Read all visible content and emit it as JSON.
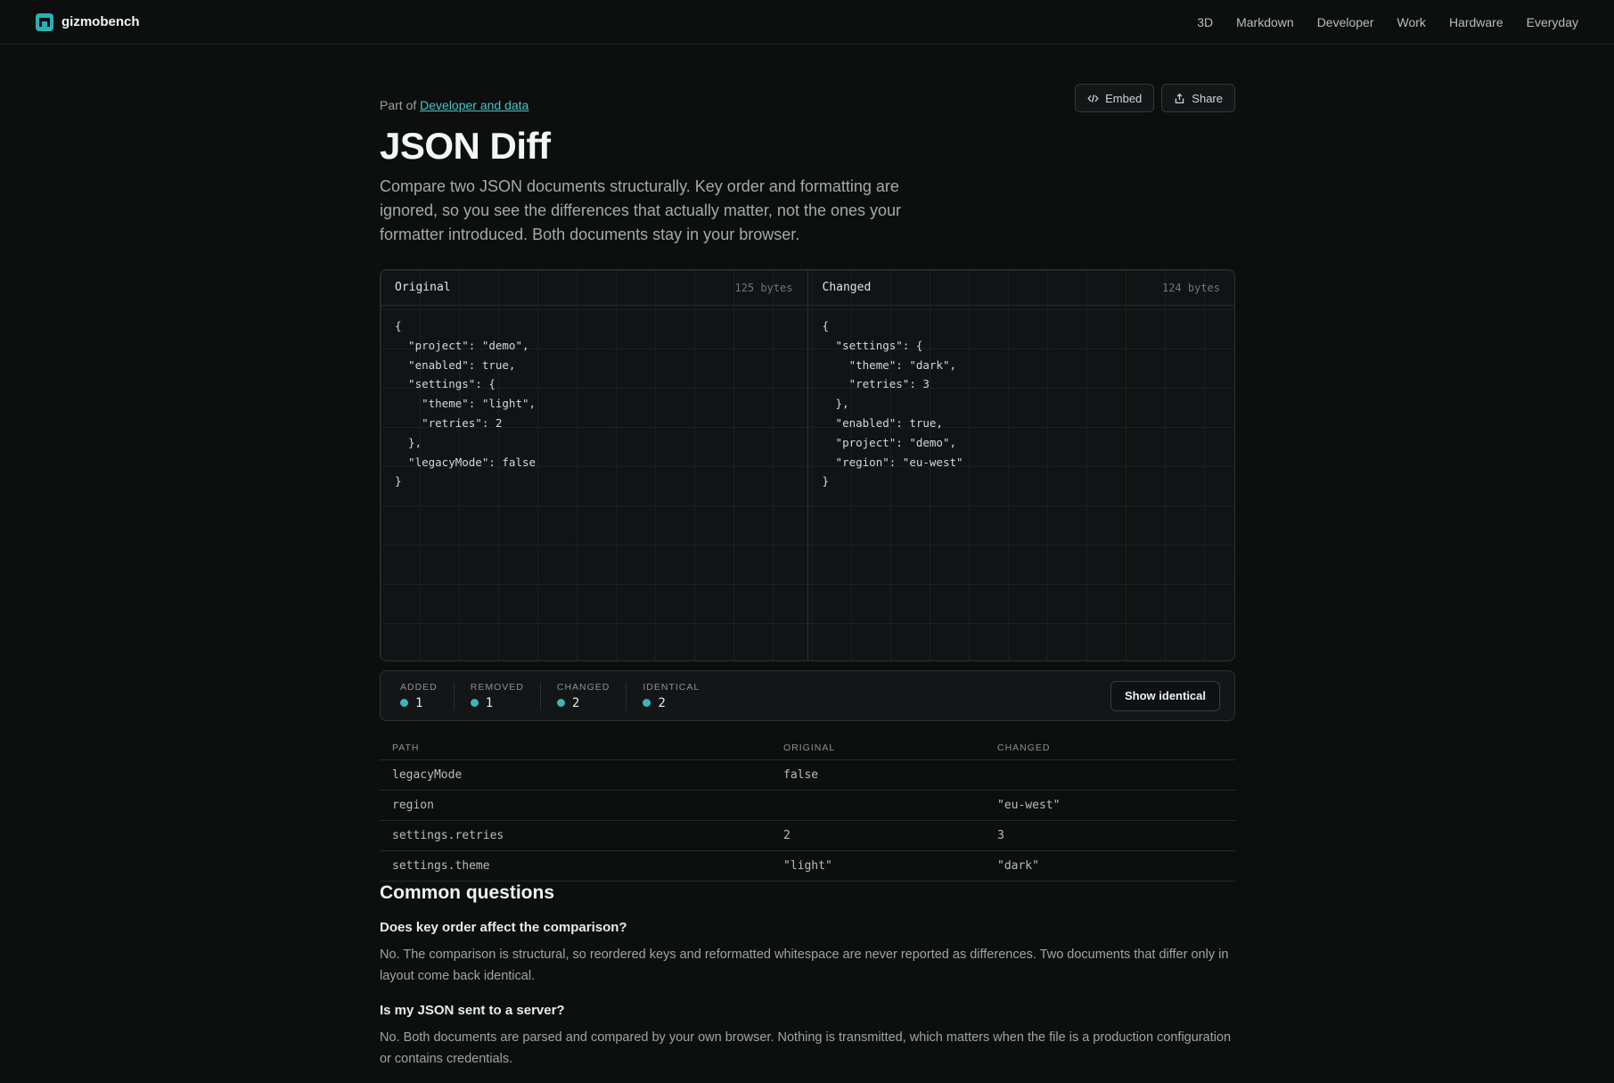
{
  "brand": {
    "name": "gizmobench"
  },
  "nav": [
    "3D",
    "Markdown",
    "Developer",
    "Work",
    "Hardware",
    "Everyday"
  ],
  "breadcrumb": {
    "prefix": "Part of",
    "link": "Developer and data"
  },
  "actions": {
    "embed": "Embed",
    "share": "Share"
  },
  "page": {
    "title": "JSON Diff",
    "description": "Compare two JSON documents structurally. Key order and formatting are ignored, so you see the differences that actually matter, not the ones your formatter introduced. Both documents stay in your browser."
  },
  "editor": {
    "original": {
      "title": "Original",
      "bytes": "125 bytes",
      "code": "{\n  \"project\": \"demo\",\n  \"enabled\": true,\n  \"settings\": {\n    \"theme\": \"light\",\n    \"retries\": 2\n  },\n  \"legacyMode\": false\n}"
    },
    "changed": {
      "title": "Changed",
      "bytes": "124 bytes",
      "code": "{\n  \"settings\": {\n    \"theme\": \"dark\",\n    \"retries\": 3\n  },\n  \"enabled\": true,\n  \"project\": \"demo\",\n  \"region\": \"eu-west\"\n}"
    }
  },
  "summary": {
    "stats": [
      {
        "label": "ADDED",
        "value": "1"
      },
      {
        "label": "REMOVED",
        "value": "1"
      },
      {
        "label": "CHANGED",
        "value": "2"
      },
      {
        "label": "IDENTICAL",
        "value": "2"
      }
    ],
    "show_identical": "Show identical",
    "dot_color": "#3fb3b8"
  },
  "diff": {
    "headers": {
      "path": "PATH",
      "original": "ORIGINAL",
      "changed": "CHANGED"
    },
    "rows": [
      {
        "path": "legacyMode",
        "original": "false",
        "changed": ""
      },
      {
        "path": "region",
        "original": "",
        "changed": "\"eu-west\""
      },
      {
        "path": "settings.retries",
        "original": "2",
        "changed": "3"
      },
      {
        "path": "settings.theme",
        "original": "\"light\"",
        "changed": "\"dark\""
      }
    ],
    "colors": {
      "original": "#e9765f",
      "changed": "#6cc36d"
    }
  },
  "faq": {
    "title": "Common questions",
    "items": [
      {
        "q": "Does key order affect the comparison?",
        "a": "No. The comparison is structural, so reordered keys and reformatted whitespace are never reported as differences. Two documents that differ only in layout come back identical."
      },
      {
        "q": "Is my JSON sent to a server?",
        "a": "No. Both documents are parsed and compared by your own browser. Nothing is transmitted, which matters when the file is a production configuration or contains credentials."
      }
    ]
  }
}
